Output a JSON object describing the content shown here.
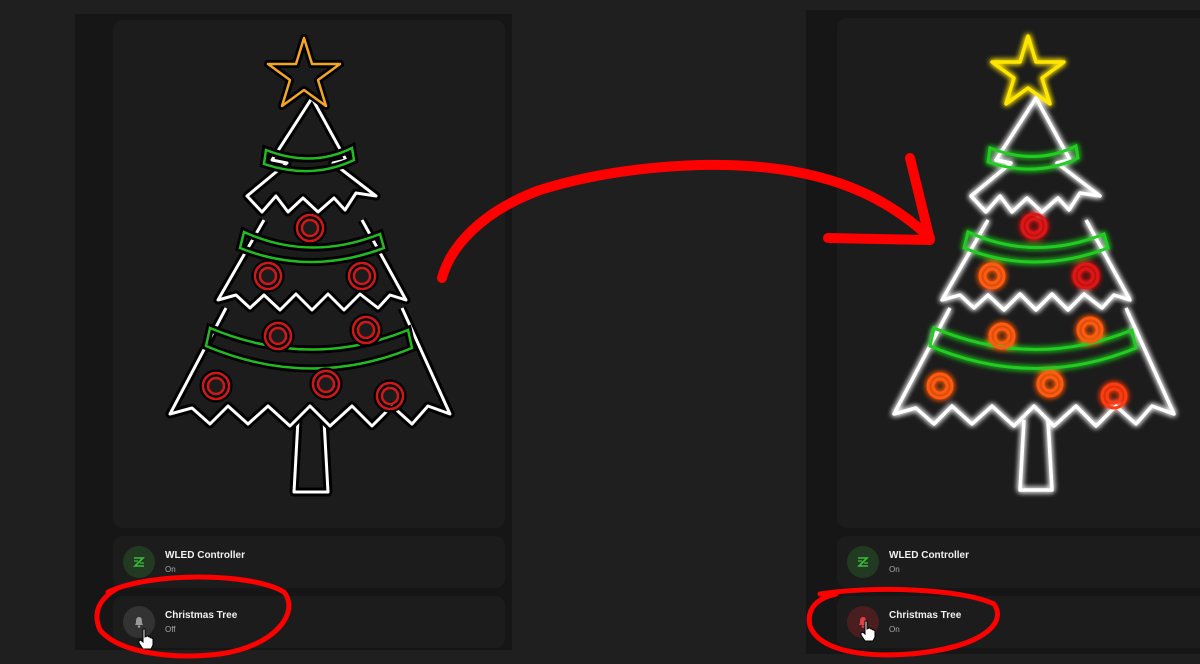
{
  "left": {
    "entities": [
      {
        "name": "WLED Controller",
        "state": "On",
        "icon": "wled-icon"
      },
      {
        "name": "Christmas Tree",
        "state": "Off",
        "icon": "bell-icon"
      }
    ]
  },
  "right": {
    "entities": [
      {
        "name": "WLED Controller",
        "state": "On",
        "icon": "wled-icon"
      },
      {
        "name": "Christmas Tree",
        "state": "On",
        "icon": "bell-icon"
      }
    ]
  },
  "colors": {
    "annotation": "#ff0000",
    "tree_off_outline": "#ffffff",
    "star_off": "#f5a623",
    "star_on": "#ffe600",
    "garland": "#22bb22",
    "ornament_off": "#d01818",
    "ornament_on": "#ff5a10",
    "wled_icon": "#3dbb3d"
  }
}
